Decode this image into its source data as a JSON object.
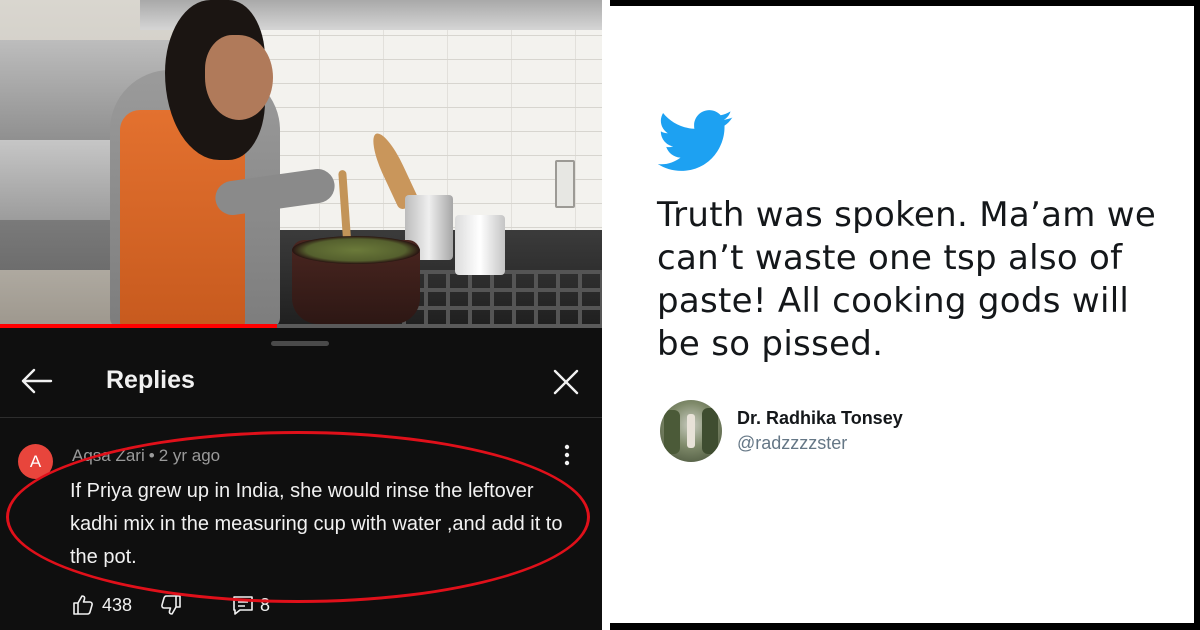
{
  "video": {
    "progress_fraction": 0.46
  },
  "replies_sheet": {
    "title": "Replies",
    "back_icon": "arrow-left-icon",
    "close_icon": "close-icon",
    "comment": {
      "avatar_letter": "A",
      "avatar_color": "#e8453c",
      "author": "Aqsa Zari",
      "separator": "•",
      "time_ago": "2 yr ago",
      "text": "If Priya grew up in India, she would rinse the leftover kadhi mix in the measuring cup with water ,and add it to the pot.",
      "likes": "438",
      "replies": "8",
      "menu_icon": "more-vertical-icon"
    },
    "highlight_color": "#e0101a"
  },
  "tweet": {
    "brand_icon": "twitter-bird-icon",
    "brand_color": "#1da1f2",
    "text": "Truth was spoken. Ma’am we can’t waste one tsp also of paste! All cooking gods will be so pissed.",
    "author_name": "Dr. Radhika Tonsey",
    "author_handle": "@radzzzzster"
  }
}
